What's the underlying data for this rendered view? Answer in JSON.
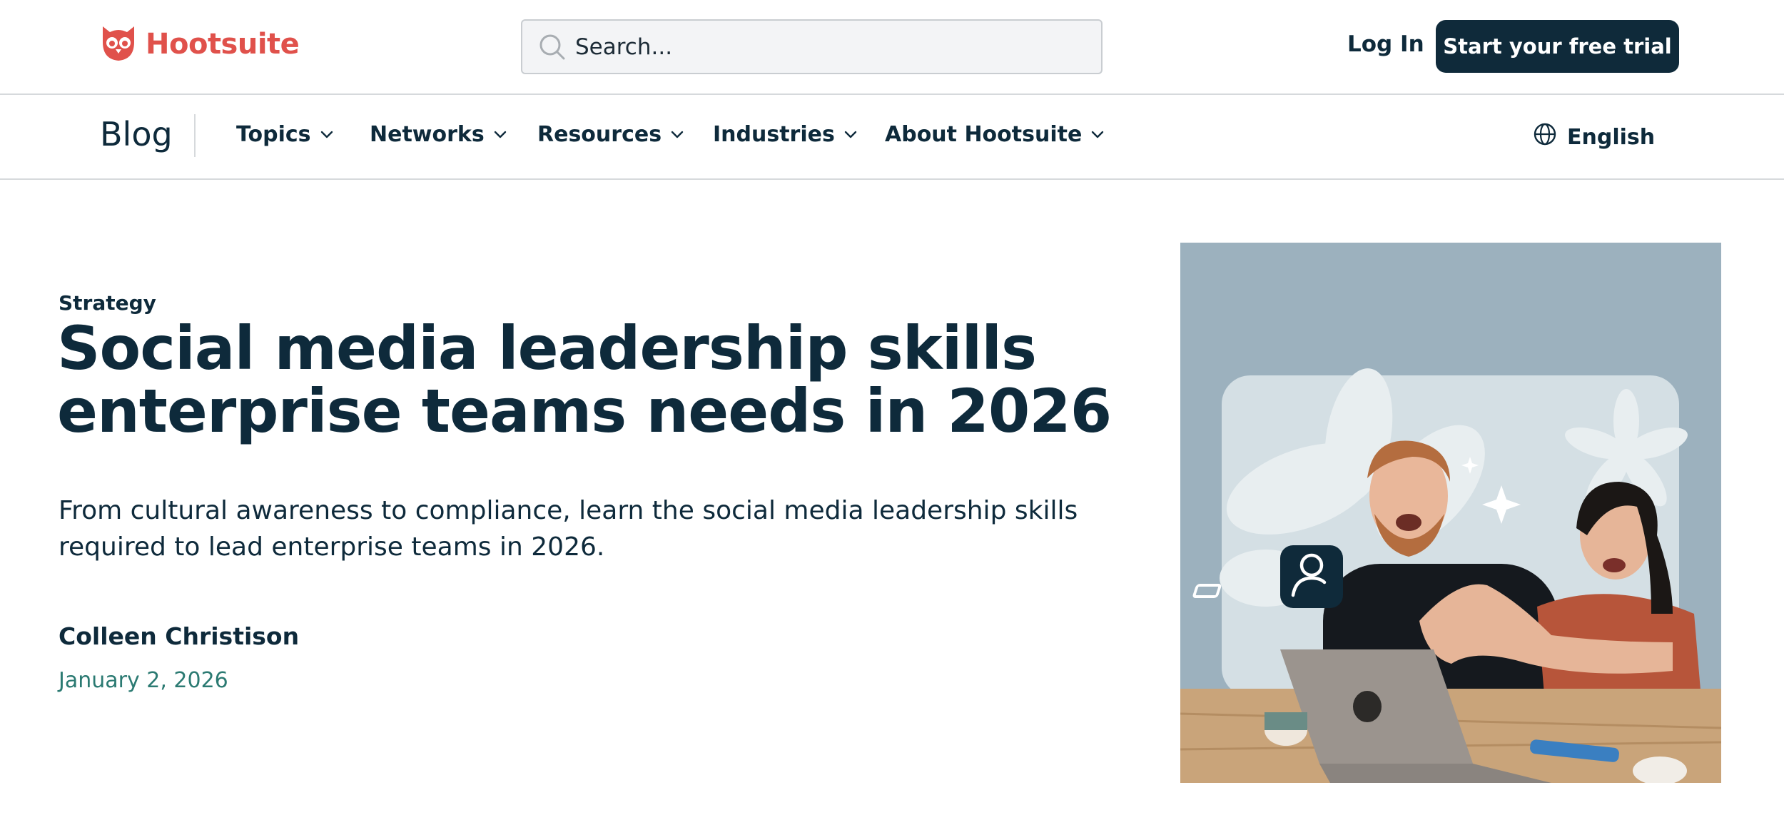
{
  "header": {
    "brand": "Hootsuite",
    "search_placeholder": "Search...",
    "login_label": "Log In",
    "trial_label": "Start your free trial"
  },
  "nav": {
    "blog_label": "Blog",
    "items": [
      {
        "label": "Topics"
      },
      {
        "label": "Networks"
      },
      {
        "label": "Resources"
      },
      {
        "label": "Industries"
      },
      {
        "label": "About Hootsuite"
      }
    ],
    "language": "English"
  },
  "article": {
    "category": "Strategy",
    "title": "Social media leadership skills enterprise teams needs in 2026",
    "subtitle": "From cultural awareness to compliance, learn the social media leadership skills required to lead enterprise teams in 2026.",
    "author": "Colleen Christison",
    "date": "January 2, 2026"
  },
  "colors": {
    "brand_red": "#e0514b",
    "navy": "#0f2a3a",
    "date_teal": "#2b7a72",
    "hero_bg": "#9cb1be"
  },
  "icons": [
    "owl-logo-icon",
    "search-icon",
    "chevron-down-icon",
    "globe-icon",
    "user-profile-icon"
  ]
}
